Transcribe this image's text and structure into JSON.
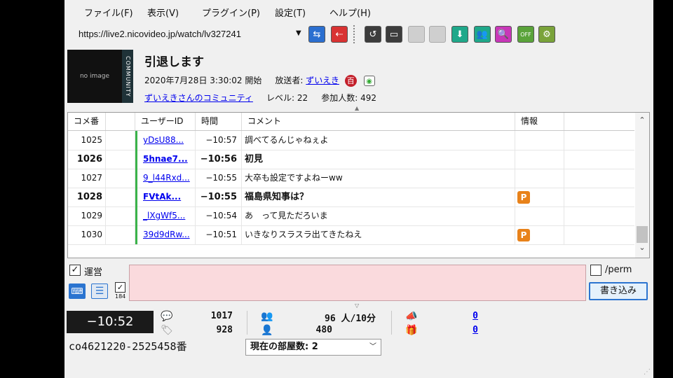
{
  "menu": [
    "ファイル(F)",
    "表示(V)",
    "プラグイン(P)",
    "設定(T)",
    "ヘルプ(H)"
  ],
  "toolbar": {
    "url": "https://live2.nicovideo.jp/watch/lv327241"
  },
  "broadcast": {
    "thumbnail_text": "no image",
    "community_label": "COMMUNITY",
    "title": "引退します",
    "start": "2020年7月28日  3:30:02 開始",
    "broadcaster_label": "放送者:",
    "broadcaster": "ずいえき",
    "badge_text": "百",
    "community_link": "ずいえきさんのコミュニティ",
    "level": "レベル: 22",
    "participants": "参加人数: 492"
  },
  "list": {
    "columns": [
      "コメ番",
      "",
      "ユーザーID",
      "時間",
      "コメント",
      "情報"
    ],
    "rows": [
      {
        "no": "1025",
        "user": "yDsU88...",
        "time": "−10:57",
        "comment": "調べてるんじゃねぇよ",
        "info": "",
        "bold": false
      },
      {
        "no": "1026",
        "user": "5hnae7...",
        "time": "−10:56",
        "comment": "初見",
        "info": "",
        "bold": true
      },
      {
        "no": "1027",
        "user": "9_l44Rxd...",
        "time": "−10:55",
        "comment": "大卒も設定ですよねーww",
        "info": "",
        "bold": false
      },
      {
        "no": "1028",
        "user": "FVtAk...",
        "time": "−10:55",
        "comment": "福島県知事は？",
        "info": "P",
        "bold": true
      },
      {
        "no": "1029",
        "user": "_lXgWf5...",
        "time": "−10:54",
        "comment": "あ　って見ただろいま",
        "info": "",
        "bold": false
      },
      {
        "no": "1030",
        "user": "39d9dRw...",
        "time": "−10:51",
        "comment": "いきなりスラスラ出てきたねえ",
        "info": "P",
        "bold": false
      }
    ]
  },
  "post": {
    "unei_label": "運営",
    "label_184": "184",
    "perm_label": "/perm",
    "submit_label": "書き込み"
  },
  "stats": {
    "timer": "−10:52",
    "comments_a": "1017",
    "comments_b": "928",
    "viewers_a": "96 人/10分",
    "viewers_b": "480",
    "ad": "0",
    "gift": "0",
    "room_id": "co4621220-2525458番",
    "room_select": "現在の部屋数: 2"
  }
}
